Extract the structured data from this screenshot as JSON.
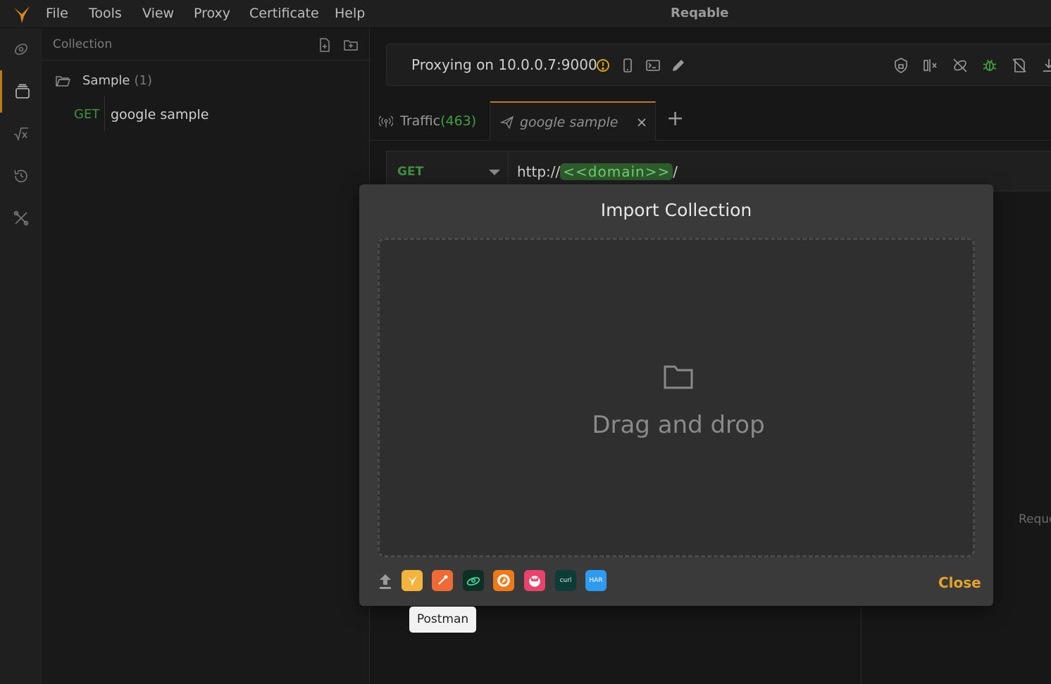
{
  "menu": {
    "items": [
      "File",
      "Tools",
      "View",
      "Proxy",
      "Certificate",
      "Help"
    ],
    "app_title": "Reqable"
  },
  "sidebar": {
    "title": "Collection",
    "folder": {
      "name": "Sample",
      "count": "(1)"
    },
    "request": {
      "method": "GET",
      "name": "google sample"
    }
  },
  "proxy": {
    "status": "Proxying on 10.0.0.7:9000"
  },
  "tabs": {
    "traffic_label": "Traffic",
    "traffic_count": "(463)",
    "sample_label": "google sample",
    "add_label": "+"
  },
  "request_bar": {
    "method": "GET",
    "url_prefix": "http://",
    "url_var": "<<domain>>",
    "url_suffix": "/"
  },
  "right_hint": "Reque",
  "modal": {
    "title": "Import Collection",
    "drop_text": "Drag and drop",
    "close_label": "Close",
    "import_sources": [
      "reqable-icon",
      "paw-icon",
      "insomnia-icon",
      "hoppscotch-icon",
      "apifox-icon",
      "curl-icon",
      "har-icon"
    ],
    "curl_text": "curl",
    "har_text": "HAR"
  },
  "tooltip": {
    "text": "Postman"
  },
  "colors": {
    "accent": "#c07a1a",
    "close": "#e6a32a",
    "get_method": "#3f8f3f",
    "var_bg": "#2e5a2e"
  }
}
